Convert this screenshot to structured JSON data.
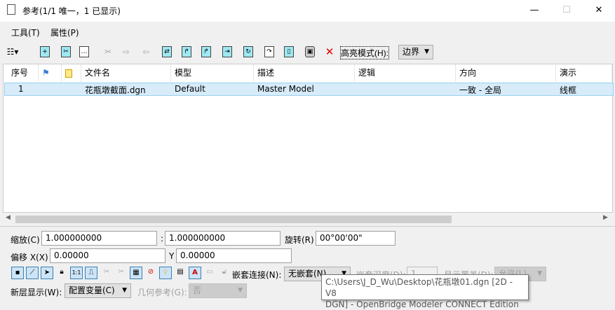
{
  "window": {
    "title": "参考(1/1 唯一，1 已显示)",
    "minimize": "—",
    "maximize": "☐",
    "close": "✕"
  },
  "menu": [
    {
      "label": "工具(T)"
    },
    {
      "label": "属性(P)"
    }
  ],
  "toolbar": {
    "highlight_label": "高亮模式(H):",
    "highlight_value": "边界"
  },
  "table": {
    "headers": [
      "序号",
      "",
      "",
      "文件名",
      "模型",
      "描述",
      "逻辑",
      "方向",
      "演示"
    ],
    "rows": [
      {
        "index": "1",
        "file": "花瓶墩截面.dgn",
        "model": "Default",
        "description": "Master Model",
        "logic": "",
        "orientation": "一致 - 全局",
        "presentation": "线框"
      }
    ]
  },
  "settings": {
    "scale_label": "缩放(C)",
    "scale_a": "1.000000000",
    "scale_sep": ":",
    "scale_b": "1.000000000",
    "rotation_label": "旋转(R)",
    "rotation": "00°00'00\"",
    "offset_label": "偏移 X(X)",
    "offset_x": "0.00000",
    "y_label": "Y",
    "offset_y": "0.00000",
    "nest_label": "嵌套连接(N):",
    "nest_value": "无嵌套(N)",
    "depth_label": "嵌套深度(D):",
    "depth_value": "1",
    "overrides_label": "显示覆盖(D):",
    "overrides_value": "允许(L)",
    "newlevel_label": "新层显示(W):",
    "newlevel_value": "配置变量(C)",
    "georef_label": "几何参考(G):",
    "georef_value": "否"
  },
  "tooltip": {
    "line1": "C:\\Users\\J_D_Wu\\Desktop\\花瓶墩01.dgn [2D - V8",
    "line2": "DGN] - OpenBridge Modeler CONNECT Edition"
  }
}
